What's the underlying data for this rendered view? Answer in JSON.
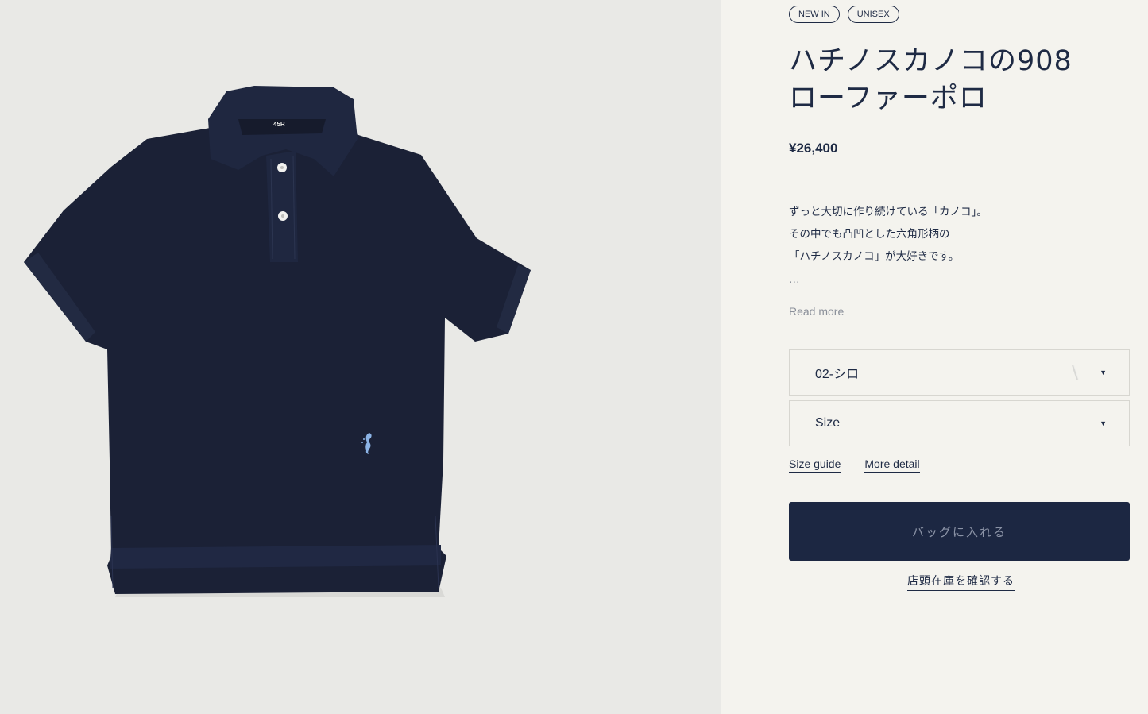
{
  "product_image": {
    "tag_label": "45R",
    "colors": {
      "background": "#e9e9e6",
      "garment": "#1b2136",
      "embroidery": "#8cb4e6"
    }
  },
  "badges": [
    "NEW IN",
    "UNISEX"
  ],
  "title": {
    "line1": "ハチノスカノコの908",
    "line2": "ローファーポロ"
  },
  "price": "¥26,400",
  "description": {
    "lines": [
      "ずっと大切に作り続けている「カノコ」。",
      "その中でも凸凹とした六角形柄の",
      "「ハチノスカノコ」が大好きです。"
    ],
    "ellipsis": "…",
    "read_more": "Read more"
  },
  "color_select": {
    "value": "02-シロ",
    "caret": "▼"
  },
  "size_select": {
    "value": "Size",
    "caret": "▼"
  },
  "links": {
    "size_guide": "Size guide",
    "more_detail": "More detail"
  },
  "add_to_bag": "バッグに入れる",
  "check_store_stock": "店頭在庫を確認する",
  "theme": {
    "navy": "#1c2742",
    "panel_bg": "#f4f3ee"
  }
}
